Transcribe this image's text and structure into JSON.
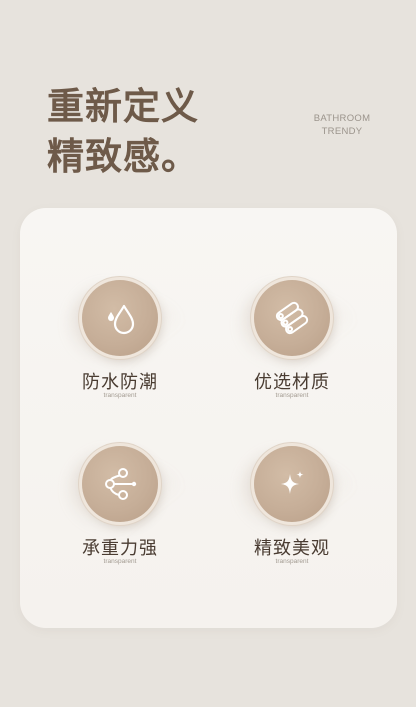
{
  "headline": {
    "line1": "重新定义",
    "line2": "精致感。"
  },
  "tag": {
    "line1": "BATHROOM",
    "line2": "TRENDY"
  },
  "features": [
    {
      "icon": "water-drop-icon",
      "label": "防水防潮",
      "sub": "transparent"
    },
    {
      "icon": "material-rolls-icon",
      "label": "优选材质",
      "sub": "transparent"
    },
    {
      "icon": "load-nodes-icon",
      "label": "承重力强",
      "sub": "transparent"
    },
    {
      "icon": "sparkle-icon",
      "label": "精致美观",
      "sub": "transparent"
    }
  ],
  "colors": {
    "background": "#e7e3dd",
    "card": "#f7f5f2",
    "accent": "#c6ae98",
    "headline": "#6e5a49"
  }
}
